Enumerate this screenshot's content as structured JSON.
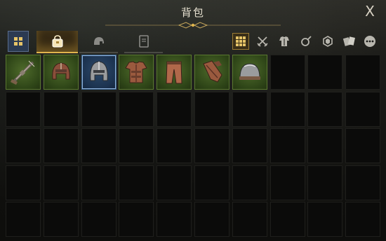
{
  "window": {
    "title": "背包",
    "close_label": "X"
  },
  "tabs": [
    {
      "id": "grid-view",
      "icon": "grid-icon",
      "active": false
    },
    {
      "id": "bag",
      "icon": "bag-icon",
      "active": true
    },
    {
      "id": "helmet",
      "icon": "helmet-icon",
      "active": false
    },
    {
      "id": "book",
      "icon": "book-icon",
      "active": false
    }
  ],
  "filters": [
    {
      "icon": "grid-icon",
      "active": true
    },
    {
      "icon": "crossed-swords-icon",
      "active": false
    },
    {
      "icon": "armor-icon",
      "active": false
    },
    {
      "icon": "frying-pan-icon",
      "active": false
    },
    {
      "icon": "gem-icon",
      "active": false
    },
    {
      "icon": "cards-icon",
      "active": false
    },
    {
      "icon": "more-icon",
      "active": false
    }
  ],
  "inventory": {
    "columns": 10,
    "rows": 5,
    "items": [
      {
        "slot": 0,
        "name": "rifle",
        "icon": "rifle-icon",
        "rarity": "green"
      },
      {
        "slot": 1,
        "name": "leather-helmet",
        "icon": "leather-helmet-icon",
        "rarity": "green"
      },
      {
        "slot": 2,
        "name": "iron-helmet",
        "icon": "iron-helmet-icon",
        "rarity": "blue"
      },
      {
        "slot": 3,
        "name": "leather-armor",
        "icon": "leather-armor-icon",
        "rarity": "green"
      },
      {
        "slot": 4,
        "name": "leather-pants",
        "icon": "leather-pants-icon",
        "rarity": "green"
      },
      {
        "slot": 5,
        "name": "leather-gloves",
        "icon": "leather-gloves-icon",
        "rarity": "green"
      },
      {
        "slot": 6,
        "name": "iron-cap",
        "icon": "iron-cap-icon",
        "rarity": "green"
      }
    ]
  },
  "colors": {
    "accent_gold": "#e1b54d",
    "rarity_green": "#4e6a2a",
    "rarity_blue": "#2d4a6a"
  }
}
